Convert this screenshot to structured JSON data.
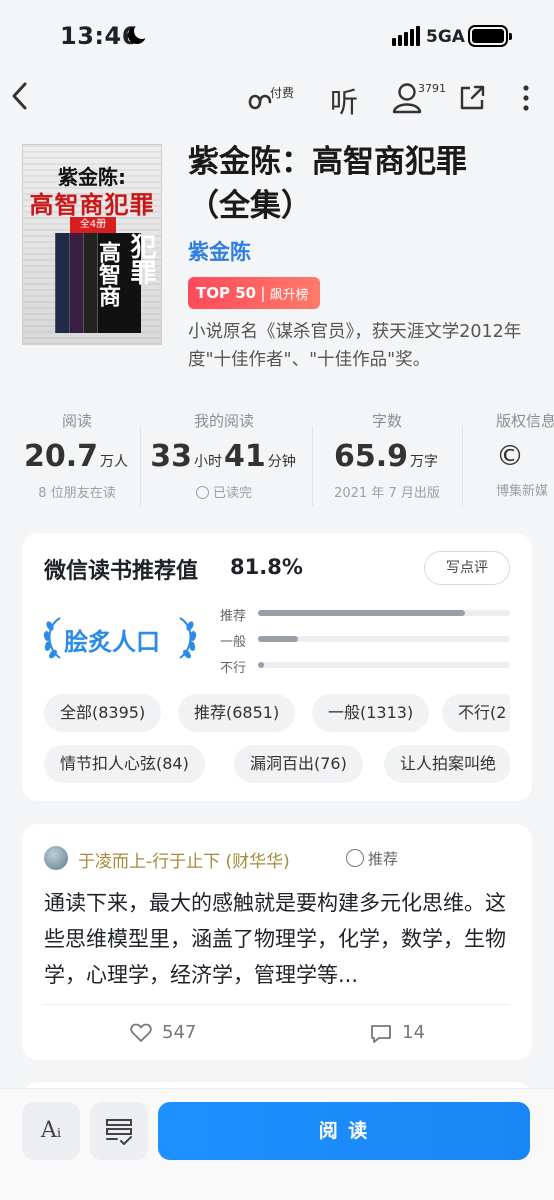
{
  "status_bar": {
    "time": "13:46",
    "network": "5GA"
  },
  "nav": {
    "paid_label": "付费",
    "listen_label": "听",
    "reader_count": "3791"
  },
  "book": {
    "cover": {
      "line1": "紫金陈:",
      "line2": "高智商犯罪",
      "badge": "全4册",
      "spine1": "高智商",
      "spine2": "犯罪"
    },
    "title": "紫金陈：高智商犯罪（全集）",
    "author": "紫金陈",
    "rank": {
      "top": "TOP 50",
      "sep": "|",
      "list": "飙升榜"
    },
    "description": "小说原名《谋杀官员》，获天涯文学2012年度\"十佳作者\"、\"十佳作品\"奖。"
  },
  "stats": [
    {
      "label": "阅读",
      "value": "20.7",
      "unit": "万人",
      "sub": "8 位朋友在读"
    },
    {
      "label": "我的阅读",
      "hours": "33",
      "hours_unit": "小时",
      "minutes": "41",
      "minutes_unit": "分钟",
      "sub": "已读完"
    },
    {
      "label": "字数",
      "value": "65.9",
      "unit": "万字",
      "sub": "2021 年 7 月出版"
    },
    {
      "label": "版权信息",
      "sub": "博集新媒"
    }
  ],
  "recommend": {
    "title": "微信读书推荐值",
    "percent": "81.8%",
    "write_btn": "写点评",
    "badge": "脍炙人口",
    "bars": [
      {
        "label": "推荐",
        "fraction": 0.82
      },
      {
        "label": "一般",
        "fraction": 0.16
      },
      {
        "label": "不行",
        "fraction": 0.02
      }
    ],
    "filters_row1": [
      "全部(8395)",
      "推荐(6851)",
      "一般(1313)",
      "不行(2"
    ],
    "filters_row2": [
      "情节扣人心弦(84)",
      "漏洞百出(76)",
      "让人拍案叫绝"
    ]
  },
  "review": {
    "user": "于凌而上-行于止下 (财华华)",
    "tag": "推荐",
    "text": "通读下来，最大的感触就是要构建多元化思维。这些思维模型里，涵盖了物理学，化学，数学，生物学，心理学，经济学，管理学等...",
    "likes": "547",
    "comments": "14"
  },
  "bottom": {
    "font_label": "Aᵢ",
    "read_label": "阅 读"
  },
  "colors": {
    "accent": "#1e90ff",
    "author": "#2f7fe0",
    "rank": "#ff4a5a",
    "reviewer": "#a88a3a"
  }
}
